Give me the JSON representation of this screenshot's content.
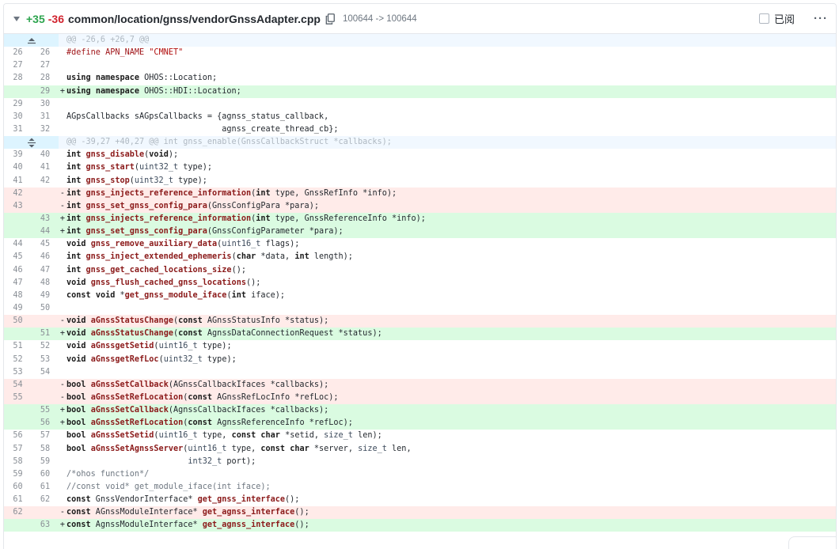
{
  "file": {
    "additions": "+35",
    "deletions": "-36",
    "path": "common/location/gnss/vendorGnssAdapter.cpp",
    "mode_change": "100644 -> 100644",
    "viewed_label": "已阅",
    "more_label": "···"
  },
  "icons": {
    "collapse": "triangle-down-icon",
    "copy": "copy-icon",
    "expand_up": "expand-up-icon",
    "expand_both": "expand-both-icon"
  },
  "colors": {
    "addition": "#2da44e",
    "deletion": "#d1242f",
    "added_row": "#dafbe1",
    "deleted_row": "#ffebe9"
  },
  "lines": [
    {
      "type": "hunk",
      "expand": "up",
      "text": "@@ -26,6 +26,7 @@"
    },
    {
      "type": "ctx",
      "old": "26",
      "new": "26",
      "text": "#define APN_NAME \"CMNET\""
    },
    {
      "type": "ctx",
      "old": "27",
      "new": "27",
      "text": ""
    },
    {
      "type": "ctx",
      "old": "28",
      "new": "28",
      "text": "using namespace OHOS::Location;"
    },
    {
      "type": "add",
      "old": "",
      "new": "29",
      "text": "using namespace OHOS::HDI::Location;"
    },
    {
      "type": "ctx",
      "old": "29",
      "new": "30",
      "text": ""
    },
    {
      "type": "ctx",
      "old": "30",
      "new": "31",
      "text": "AGpsCallbacks sAGpsCallbacks = {agnss_status_callback,"
    },
    {
      "type": "ctx",
      "old": "31",
      "new": "32",
      "text": "                                agnss_create_thread_cb};"
    },
    {
      "type": "hunk",
      "expand": "both",
      "text": "@@ -39,27 +40,27 @@ int gnss_enable(GnssCallbackStruct *callbacks);"
    },
    {
      "type": "ctx",
      "old": "39",
      "new": "40",
      "text": "int gnss_disable(void);"
    },
    {
      "type": "ctx",
      "old": "40",
      "new": "41",
      "text": "int gnss_start(uint32_t type);"
    },
    {
      "type": "ctx",
      "old": "41",
      "new": "42",
      "text": "int gnss_stop(uint32_t type);"
    },
    {
      "type": "del",
      "old": "42",
      "new": "",
      "text": "int gnss_injects_reference_information(int type, GnssRefInfo *info);"
    },
    {
      "type": "del",
      "old": "43",
      "new": "",
      "text": "int gnss_set_gnss_config_para(GnssConfigPara *para);"
    },
    {
      "type": "add",
      "old": "",
      "new": "43",
      "text": "int gnss_injects_reference_information(int type, GnssReferenceInfo *info);"
    },
    {
      "type": "add",
      "old": "",
      "new": "44",
      "text": "int gnss_set_gnss_config_para(GnssConfigParameter *para);"
    },
    {
      "type": "ctx",
      "old": "44",
      "new": "45",
      "text": "void gnss_remove_auxiliary_data(uint16_t flags);"
    },
    {
      "type": "ctx",
      "old": "45",
      "new": "46",
      "text": "int gnss_inject_extended_ephemeris(char *data, int length);"
    },
    {
      "type": "ctx",
      "old": "46",
      "new": "47",
      "text": "int gnss_get_cached_locations_size();"
    },
    {
      "type": "ctx",
      "old": "47",
      "new": "48",
      "text": "void gnss_flush_cached_gnss_locations();"
    },
    {
      "type": "ctx",
      "old": "48",
      "new": "49",
      "text": "const void *get_gnss_module_iface(int iface);"
    },
    {
      "type": "ctx",
      "old": "49",
      "new": "50",
      "text": ""
    },
    {
      "type": "del",
      "old": "50",
      "new": "",
      "text": "void aGnssStatusChange(const AGnssStatusInfo *status);"
    },
    {
      "type": "add",
      "old": "",
      "new": "51",
      "text": "void aGnssStatusChange(const AgnssDataConnectionRequest *status);"
    },
    {
      "type": "ctx",
      "old": "51",
      "new": "52",
      "text": "void aGnssgetSetid(uint16_t type);"
    },
    {
      "type": "ctx",
      "old": "52",
      "new": "53",
      "text": "void aGnssgetRefLoc(uint32_t type);"
    },
    {
      "type": "ctx",
      "old": "53",
      "new": "54",
      "text": ""
    },
    {
      "type": "del",
      "old": "54",
      "new": "",
      "text": "bool aGnssSetCallback(AGnssCallbackIfaces *callbacks);"
    },
    {
      "type": "del",
      "old": "55",
      "new": "",
      "text": "bool aGnssSetRefLocation(const AGnssRefLocInfo *refLoc);"
    },
    {
      "type": "add",
      "old": "",
      "new": "55",
      "text": "bool aGnssSetCallback(AgnssCallbackIfaces *callbacks);"
    },
    {
      "type": "add",
      "old": "",
      "new": "56",
      "text": "bool aGnssSetRefLocation(const AgnssReferenceInfo *refLoc);"
    },
    {
      "type": "ctx",
      "old": "56",
      "new": "57",
      "text": "bool aGnssSetSetid(uint16_t type, const char *setid, size_t len);"
    },
    {
      "type": "ctx",
      "old": "57",
      "new": "58",
      "text": "bool aGnssSetAgnssServer(uint16_t type, const char *server, size_t len,"
    },
    {
      "type": "ctx",
      "old": "58",
      "new": "59",
      "text": "                         int32_t port);"
    },
    {
      "type": "ctx",
      "old": "59",
      "new": "60",
      "text": "/*ohos function*/"
    },
    {
      "type": "ctx",
      "old": "60",
      "new": "61",
      "text": "//const void* get_module_iface(int iface);"
    },
    {
      "type": "ctx",
      "old": "61",
      "new": "62",
      "text": "const GnssVendorInterface* get_gnss_interface();"
    },
    {
      "type": "del",
      "old": "62",
      "new": "",
      "text": "const AGnssModuleInterface* get_agnss_interface();"
    },
    {
      "type": "add",
      "old": "",
      "new": "63",
      "text": "const AgnssModuleInterface* get_agnss_interface();"
    }
  ]
}
